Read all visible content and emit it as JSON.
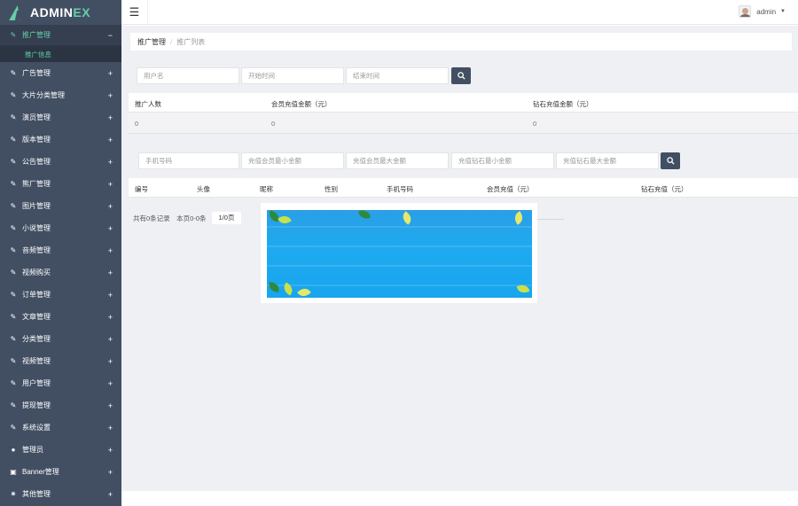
{
  "app": {
    "logo_prefix": "ADMIN",
    "logo_suffix": "EX"
  },
  "header": {
    "username": "admin"
  },
  "sidebar": {
    "active": {
      "label": "推广管理",
      "toggle": "−"
    },
    "sub": {
      "label": "推广信息"
    },
    "items": [
      {
        "icon": "edit-icon",
        "label": "广告管理"
      },
      {
        "icon": "edit-icon",
        "label": "大片分类管理"
      },
      {
        "icon": "edit-icon",
        "label": "演员管理"
      },
      {
        "icon": "edit-icon",
        "label": "版本管理"
      },
      {
        "icon": "edit-icon",
        "label": "公告管理"
      },
      {
        "icon": "edit-icon",
        "label": "熊厂管理"
      },
      {
        "icon": "edit-icon",
        "label": "图片管理"
      },
      {
        "icon": "edit-icon",
        "label": "小说管理"
      },
      {
        "icon": "edit-icon",
        "label": "音频管理"
      },
      {
        "icon": "edit-icon",
        "label": "视频购买"
      },
      {
        "icon": "edit-icon",
        "label": "订单管理"
      },
      {
        "icon": "edit-icon",
        "label": "文章管理"
      },
      {
        "icon": "edit-icon",
        "label": "分类管理"
      },
      {
        "icon": "edit-icon",
        "label": "视频管理"
      },
      {
        "icon": "edit-icon",
        "label": "用户管理"
      },
      {
        "icon": "edit-icon",
        "label": "提现管理"
      },
      {
        "icon": "edit-icon",
        "label": "系统设置"
      },
      {
        "icon": "user-icon",
        "label": "管理员"
      },
      {
        "icon": "image-icon",
        "label": "Banner管理"
      },
      {
        "icon": "gear-icon",
        "label": "其他管理"
      }
    ],
    "expand_glyph": "+"
  },
  "breadcrumb": {
    "level1": "推广管理",
    "separator": "/",
    "level2": "推广列表"
  },
  "filters1": {
    "username": "用户名",
    "start_time": "开始时间",
    "end_time": "结束时间"
  },
  "summary_table": {
    "headers": [
      "推广人数",
      "会员充值金额（元）",
      "钻石充值金额（元）"
    ],
    "values": [
      "0",
      "0",
      "0"
    ]
  },
  "filters2": {
    "phone": "手机号码",
    "vip_min": "充值会员最小金额",
    "vip_max": "充值会员最大金额",
    "diamond_min": "充值钻石最小金额",
    "diamond_max": "充值钻石最大金额"
  },
  "list_table": {
    "headers": [
      "编号",
      "头像",
      "昵称",
      "性别",
      "手机号码",
      "会员充值（元）",
      "钻石充值（元）"
    ]
  },
  "pagination": {
    "summary": "共有0条记录　本页0-0条",
    "page": "1/0页"
  },
  "colors": {
    "sidebar": "#424f63",
    "accent": "#65cea7",
    "content_bg": "#eff0f4",
    "popup_sky": "#1eaaf0"
  }
}
